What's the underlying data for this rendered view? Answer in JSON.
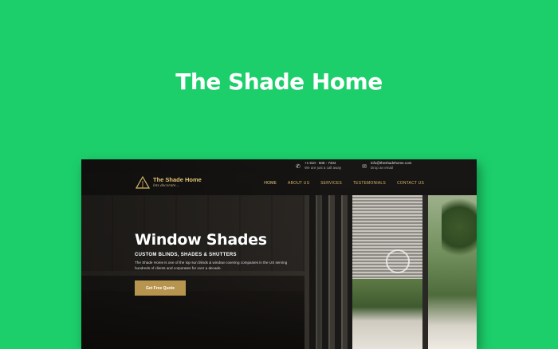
{
  "page": {
    "heading": "The Shade Home"
  },
  "colors": {
    "background": "#1ccf6b",
    "accent_gold": "#b8954e",
    "nav_text": "#d6b365"
  },
  "site": {
    "topbar": {
      "phone": {
        "icon": "phone-icon",
        "line1": "+1 910 - 506 - 7334",
        "line2": "We are just a call away"
      },
      "email": {
        "icon": "mail-icon",
        "line1": "info@theshadehome.com",
        "line2": "Drop an email"
      }
    },
    "logo": {
      "name": "The Shade Home",
      "tagline": "lets decorate..."
    },
    "nav": {
      "items": [
        "HOME",
        "ABOUT US",
        "SERVICES",
        "TESTEMONIALS",
        "CONTACT US"
      ]
    },
    "hero": {
      "title": "Window Shades",
      "subtitle": "CUSTOM BLINDS, SHADES & SHUTTERS",
      "description": "The Shade Home is one of the top sun blinds & window covering companies in the US serving hundreds of clients and corporates for over a decade.",
      "cta_label": "Get Free Quote"
    }
  }
}
